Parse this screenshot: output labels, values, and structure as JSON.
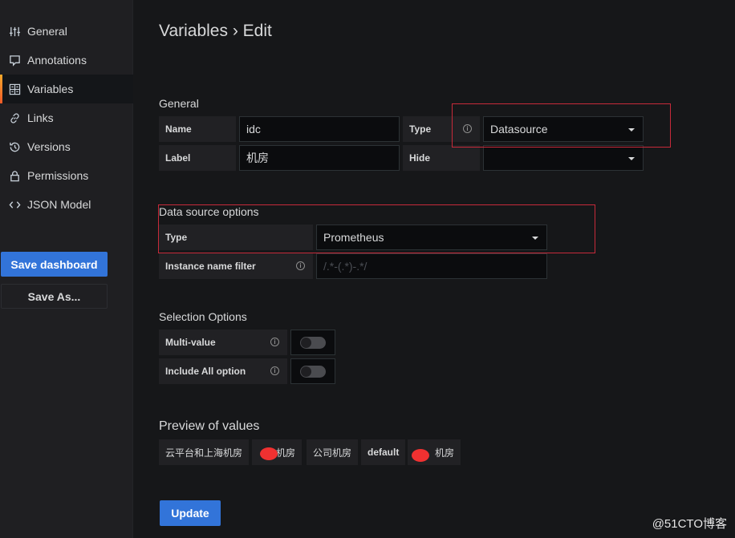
{
  "sidebar": {
    "items": [
      {
        "label": "General",
        "icon": "sliders-icon"
      },
      {
        "label": "Annotations",
        "icon": "comment-icon"
      },
      {
        "label": "Variables",
        "icon": "calculator-icon",
        "active": true
      },
      {
        "label": "Links",
        "icon": "link-icon"
      },
      {
        "label": "Versions",
        "icon": "history-icon"
      },
      {
        "label": "Permissions",
        "icon": "lock-icon"
      },
      {
        "label": "JSON Model",
        "icon": "code-icon"
      }
    ],
    "save_dashboard_label": "Save dashboard",
    "save_as_label": "Save As..."
  },
  "page": {
    "title": "Variables › Edit"
  },
  "general": {
    "title": "General",
    "name_label": "Name",
    "name_value": "idc",
    "label_label": "Label",
    "label_value": "机房",
    "type_label": "Type",
    "type_value": "Datasource",
    "hide_label": "Hide",
    "hide_value": ""
  },
  "datasource_options": {
    "title": "Data source options",
    "type_label": "Type",
    "type_value": "Prometheus",
    "instance_filter_label": "Instance name filter",
    "instance_filter_placeholder": "/.*-(.*)-.*/",
    "instance_filter_value": ""
  },
  "selection_options": {
    "title": "Selection Options",
    "multi_value_label": "Multi-value",
    "multi_value_enabled": false,
    "include_all_label": "Include All option",
    "include_all_enabled": false
  },
  "preview": {
    "title": "Preview of values",
    "values": [
      "云平台和上海机房",
      "机房",
      "公司机房",
      "default",
      "机房"
    ]
  },
  "actions": {
    "update_label": "Update"
  },
  "watermark": "@51CTO博客",
  "colors": {
    "primary": "#3274d9",
    "highlight": "#c72a3a",
    "active_accent": "#f6a92b"
  }
}
